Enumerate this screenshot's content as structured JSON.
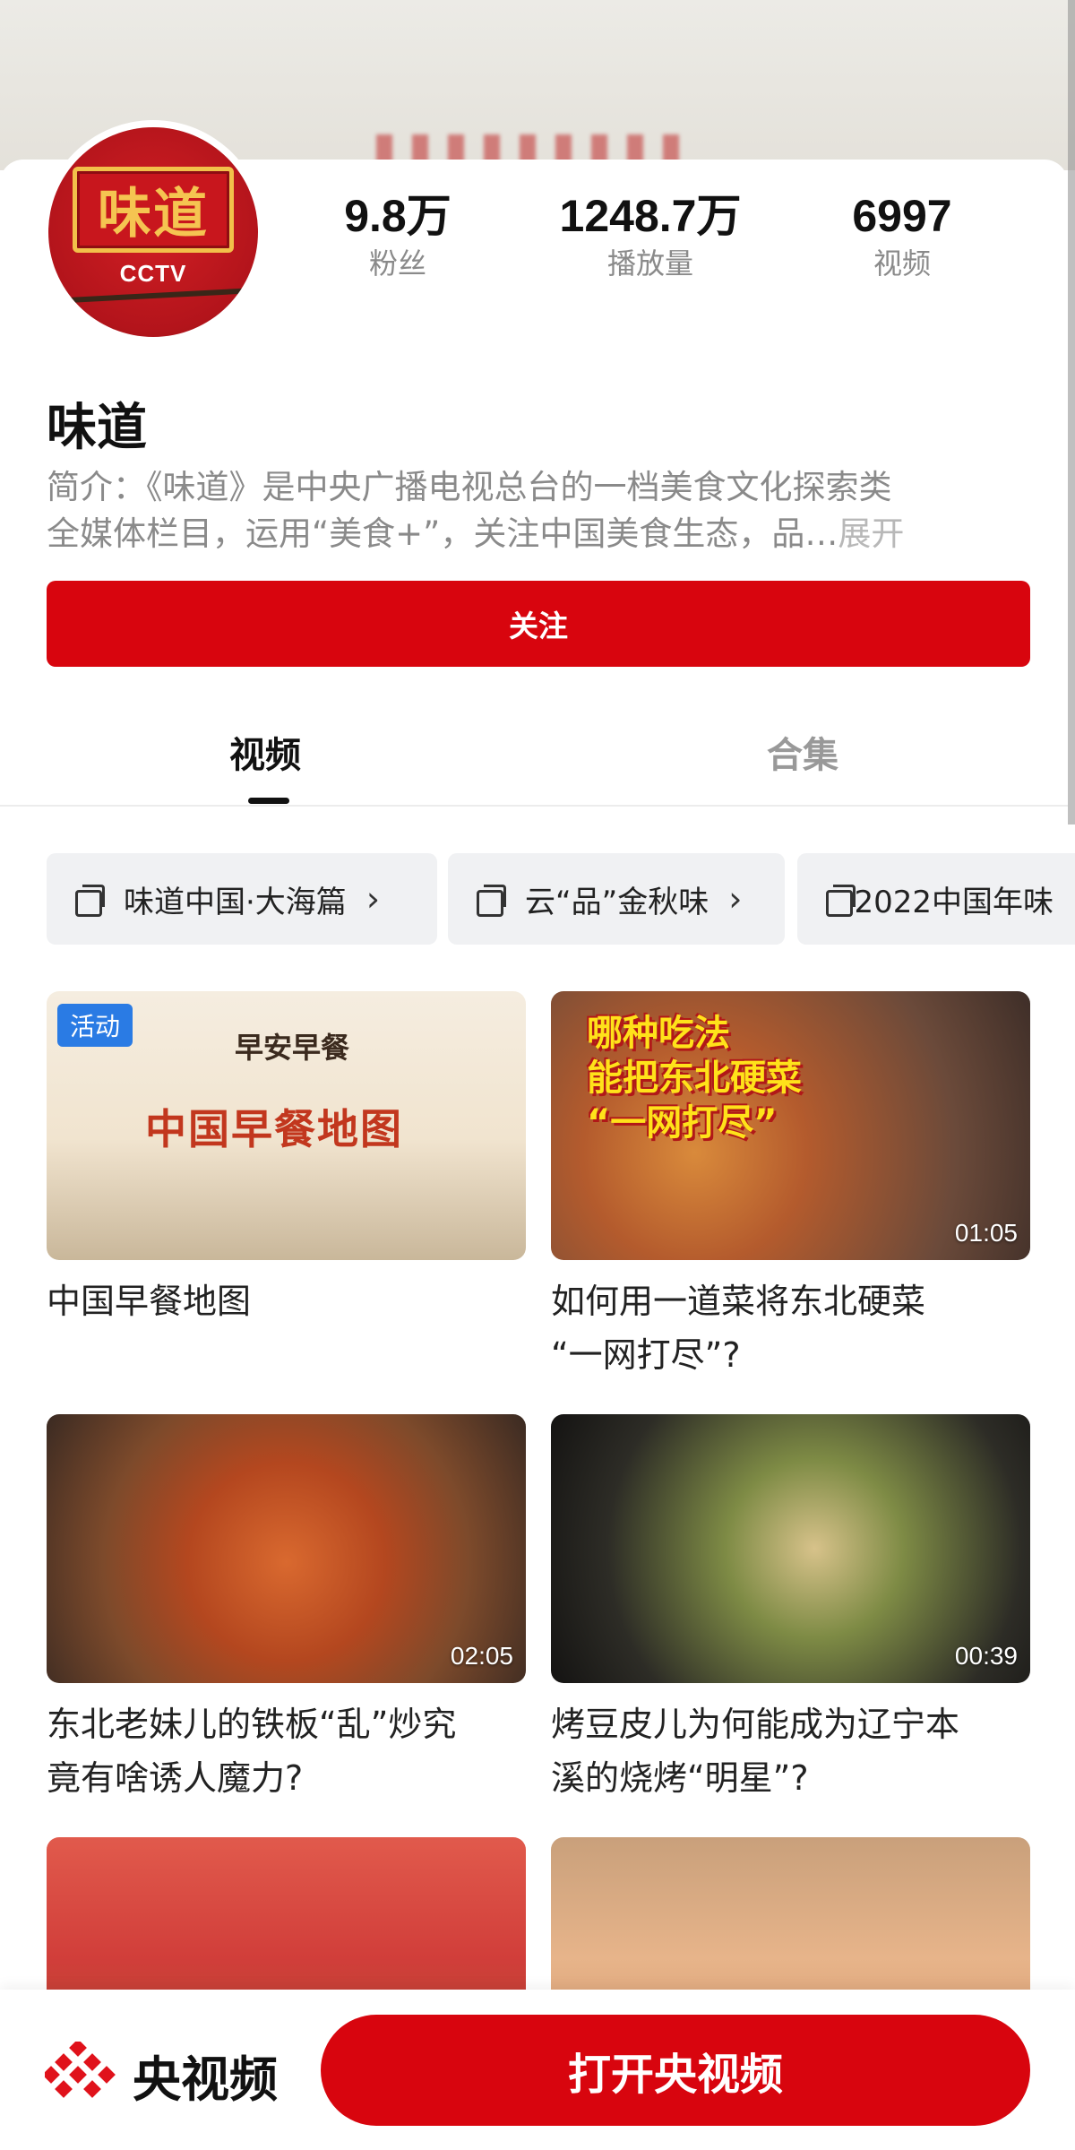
{
  "channel": {
    "name": "味道",
    "avatar_text": "味道",
    "avatar_sub": "CCTV",
    "intro_line1": "简介：《味道》是中央广播电视总台的一档美食文化探索类",
    "intro_line2": "全媒体栏目，运用“美食+”，关注中国美食生态，品…",
    "intro_more": "展开"
  },
  "stats": [
    {
      "value": "9.8万",
      "label": "粉丝"
    },
    {
      "value": "1248.7万",
      "label": "播放量"
    },
    {
      "value": "6997",
      "label": "视频"
    }
  ],
  "follow_label": "关注",
  "tabs": [
    {
      "label": "视频",
      "active": true
    },
    {
      "label": "合集",
      "active": false
    }
  ],
  "collections": [
    {
      "label": "味道中国·大海篇",
      "icon": "collection-icon"
    },
    {
      "label": "云“品”金秋味",
      "icon": "collection-icon"
    },
    {
      "label": "2022中国年味",
      "icon": "collection-icon"
    }
  ],
  "videos": [
    {
      "title": "中国早餐地图",
      "badge": "活动",
      "duration": "",
      "thumb_title": "中国早餐地图",
      "thumb_sub": "早安早餐"
    },
    {
      "title_line1": "如何用一道菜将东北硬菜",
      "title_line2": "“一网打尽”?",
      "duration": "01:05",
      "thumb_title_line1": "哪种吃法",
      "thumb_title_line2": "能把东北硬菜",
      "thumb_title_line3": "“一网打尽”"
    },
    {
      "title_line1": "东北老妹儿的铁板“乱”炒究",
      "title_line2": "竟有啥诱人魔力?",
      "duration": "02:05"
    },
    {
      "title_line1": "烤豆皮儿为何能成为辽宁本",
      "title_line2": "溪的烧烤“明星”?",
      "duration": "00:39"
    },
    {
      "title": "",
      "duration": ""
    },
    {
      "title": "",
      "duration": ""
    }
  ],
  "bottom_bar": {
    "brand": "央视频",
    "open_label": "打开央视频"
  },
  "colors": {
    "accent": "#d8050e",
    "badge": "#2a7be4"
  }
}
